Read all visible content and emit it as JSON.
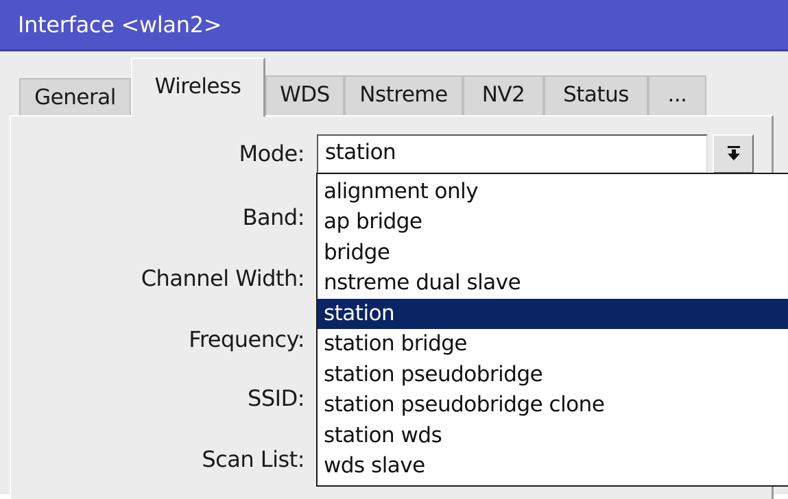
{
  "window": {
    "title": "Interface <wlan2>"
  },
  "tabs": [
    {
      "label": "General"
    },
    {
      "label": "Wireless",
      "active": true
    },
    {
      "label": "WDS"
    },
    {
      "label": "Nstreme"
    },
    {
      "label": "NV2"
    },
    {
      "label": "Status"
    },
    {
      "label": "..."
    }
  ],
  "fields": {
    "mode_label": "Mode:",
    "band_label": "Band:",
    "channel_width_label": "Channel Width:",
    "frequency_label": "Frequency:",
    "ssid_label": "SSID:",
    "scan_list_label": "Scan List:"
  },
  "mode": {
    "value": "station",
    "button_icon": "dropdown-arrow-icon",
    "options": [
      "alignment only",
      "ap bridge",
      "bridge",
      "nstreme dual slave",
      "station",
      "station bridge",
      "station pseudobridge",
      "station pseudobridge clone",
      "station wds",
      "wds slave"
    ],
    "selected_option": "station"
  },
  "colors": {
    "titlebar": "#4f54c8",
    "selection": "#0b2464",
    "panel": "#ececec"
  }
}
